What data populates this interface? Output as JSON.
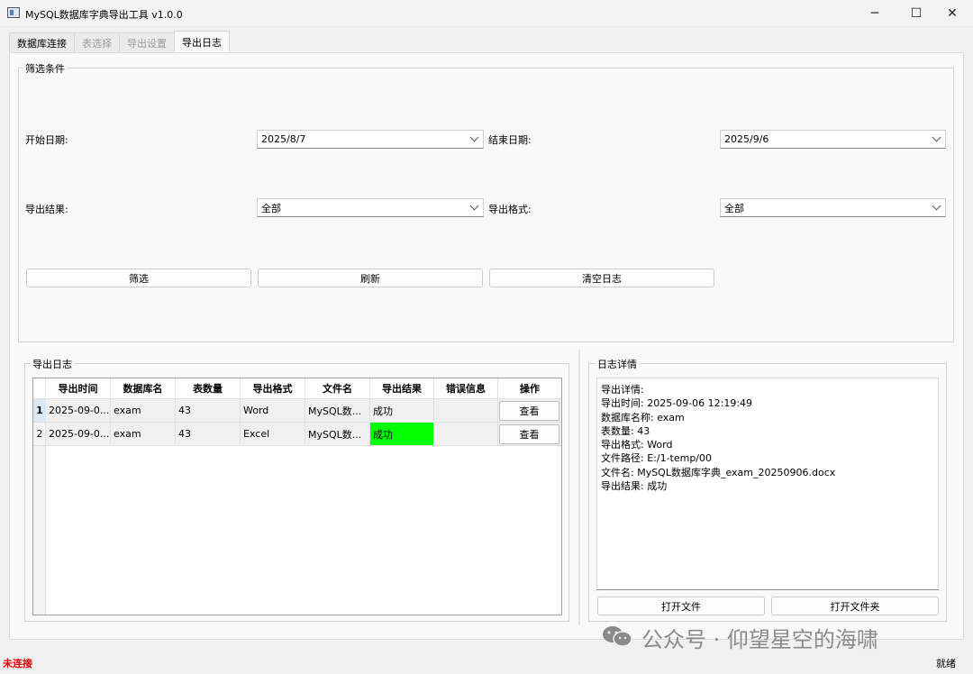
{
  "window": {
    "title": "MySQL数据库字典导出工具 v1.0.0",
    "controls": {
      "minimize": "─",
      "maximize": "☐",
      "close": "✕"
    }
  },
  "tabs": [
    {
      "label": "数据库连接",
      "state": "enabled"
    },
    {
      "label": "表选择",
      "state": "disabled"
    },
    {
      "label": "导出设置",
      "state": "disabled"
    },
    {
      "label": "导出日志",
      "state": "active"
    }
  ],
  "filter": {
    "group_title": "筛选条件",
    "start_date_label": "开始日期:",
    "start_date_value": "2025/8/7",
    "end_date_label": "结束日期:",
    "end_date_value": "2025/9/6",
    "result_label": "导出结果:",
    "result_value": "全部",
    "format_label": "导出格式:",
    "format_value": "全部",
    "filter_button": "筛选",
    "refresh_button": "刷新",
    "clear_button": "清空日志"
  },
  "log": {
    "group_title": "导出日志",
    "columns": [
      "导出时间",
      "数据库名",
      "表数量",
      "导出格式",
      "文件名",
      "导出结果",
      "错误信息",
      "操作"
    ],
    "rows": [
      {
        "num": "1",
        "time": "2025-09-0...",
        "db": "exam",
        "tables": "43",
        "format": "Word",
        "file": "MySQL数...",
        "result": "成功",
        "error": "",
        "action": "查看"
      },
      {
        "num": "2",
        "time": "2025-09-0...",
        "db": "exam",
        "tables": "43",
        "format": "Excel",
        "file": "MySQL数...",
        "result": "成功",
        "error": "",
        "action": "查看"
      }
    ],
    "success_highlight_color": "#00ff00"
  },
  "details": {
    "group_title": "日志详情",
    "lines": [
      "导出详情:",
      "导出时间: 2025-09-06 12:19:49",
      "数据库名称: exam",
      "表数量: 43",
      "导出格式: Word",
      "文件路径: E:/1-temp/00",
      "文件名: MySQL数据库字典_exam_20250906.docx",
      "导出结果: 成功"
    ],
    "open_file_button": "打开文件",
    "open_folder_button": "打开文件夹"
  },
  "status": {
    "connection": "未连接",
    "connection_color": "#e00000",
    "ready": "就绪"
  },
  "watermark": {
    "text": "公众号 · 仰望星空的海啸",
    "icon": "wechat-icon"
  }
}
